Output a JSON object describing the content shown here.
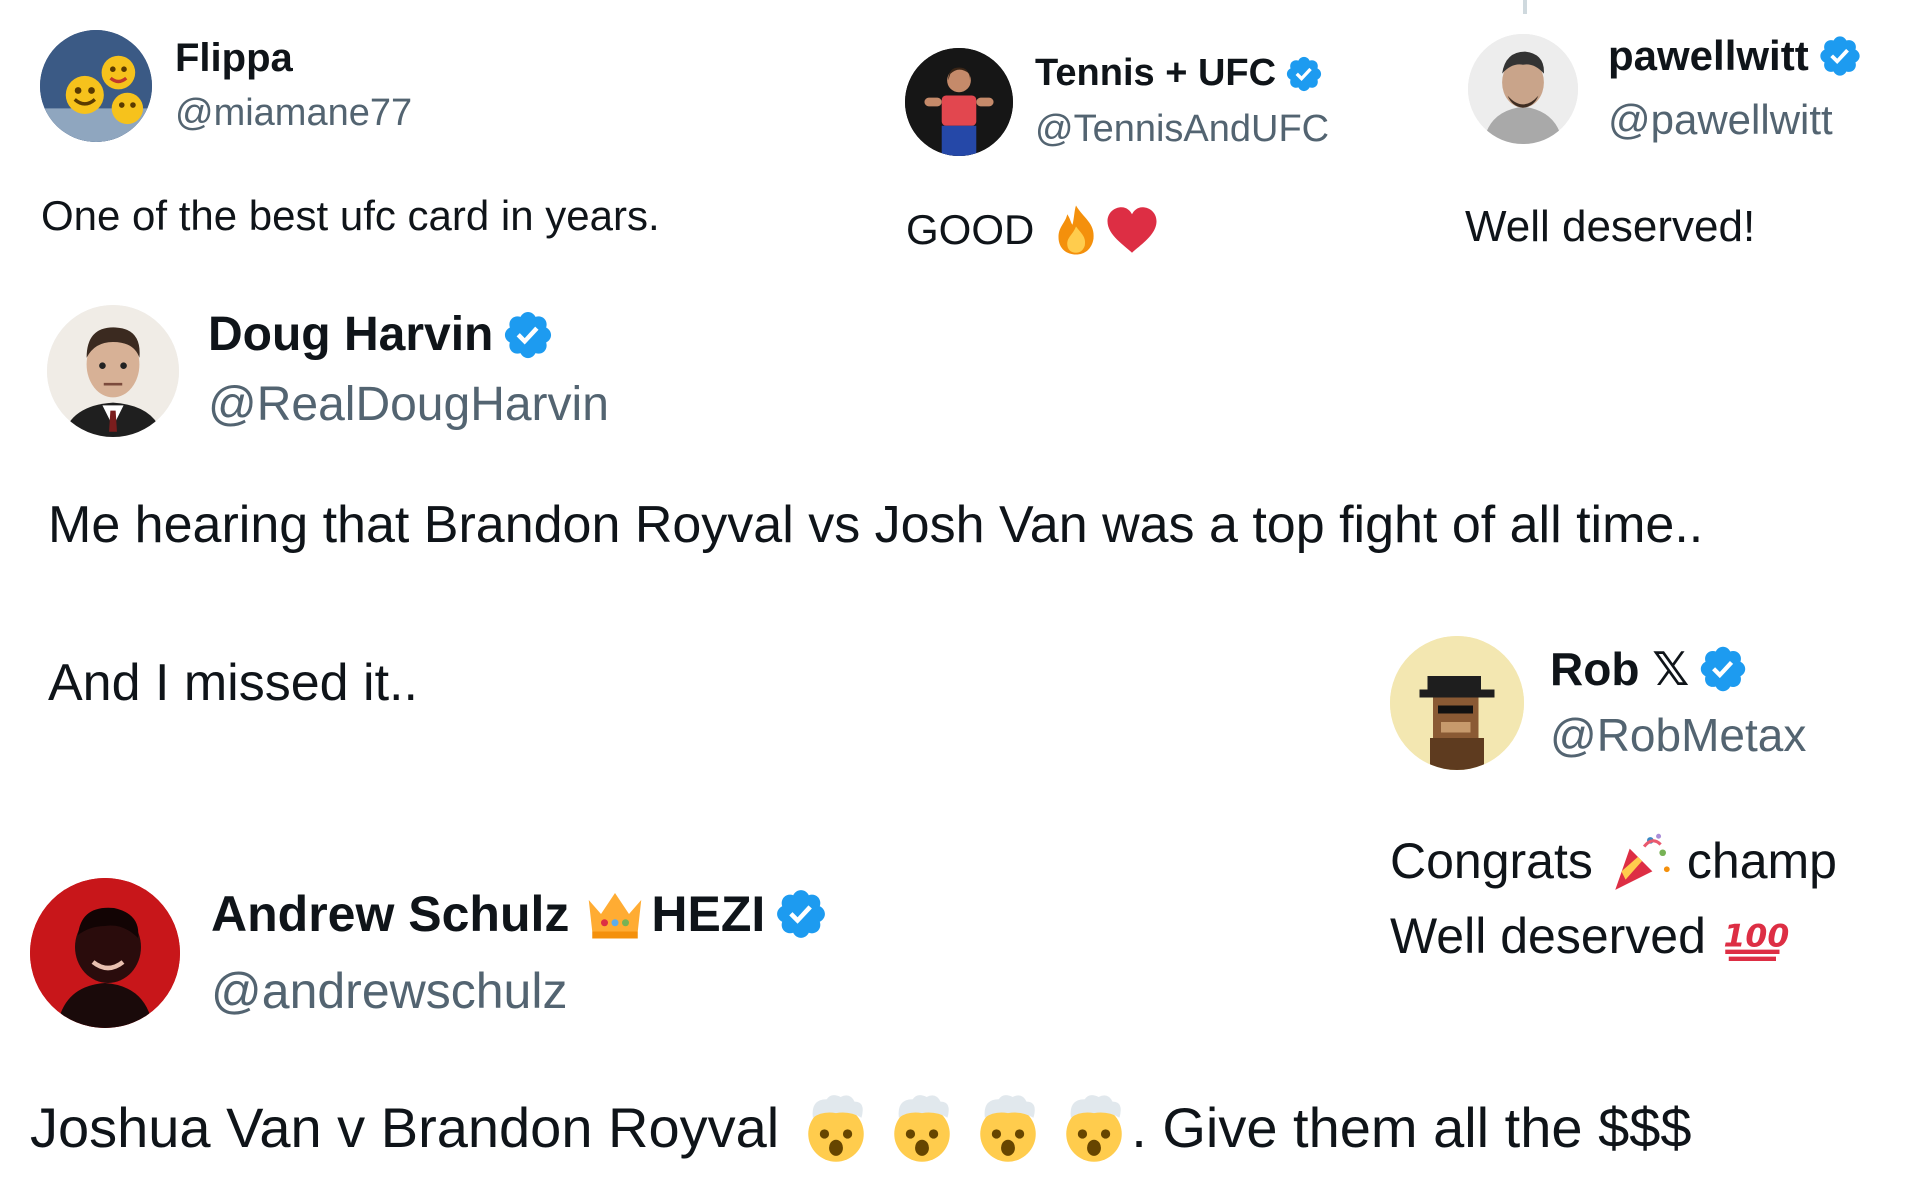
{
  "tweets": [
    {
      "name": "Flippa",
      "handle": "@miamane77",
      "verified": false,
      "text": "One of the best ufc card in years."
    },
    {
      "name": "Tennis + UFC",
      "handle": "@TennisAndUFC",
      "verified": true,
      "text": "GOOD",
      "text_emojis": [
        "fire",
        "red-heart"
      ]
    },
    {
      "name": "pawellwitt",
      "handle": "@pawellwitt",
      "verified": true,
      "text": "Well deserved!"
    },
    {
      "name": "Doug Harvin",
      "handle": "@RealDougHarvin",
      "verified": true,
      "lines": [
        "Me hearing that Brandon Royval vs Josh Van was a top fight of all time..",
        "And I missed it.."
      ]
    },
    {
      "name": "Rob 𝕏",
      "handle": "@RobMetax",
      "verified": true,
      "line1_a": "Congrats",
      "line1_b": "champ",
      "line2": "Well deserved",
      "emojis": [
        "party-popper",
        "hundred-points"
      ]
    },
    {
      "name_a": "Andrew Schulz",
      "name_b": "HEZI",
      "handle": "@andrewschulz",
      "verified": true,
      "text_a": "Joshua Van v Brandon Royval",
      "text_b": ". Give them all the $$$",
      "emojis": [
        "crown",
        "exploding-head",
        "exploding-head",
        "exploding-head",
        "exploding-head"
      ]
    }
  ],
  "colors": {
    "verified_blue": "#1d9bf0",
    "text": "#0f1419",
    "secondary": "#536471"
  }
}
